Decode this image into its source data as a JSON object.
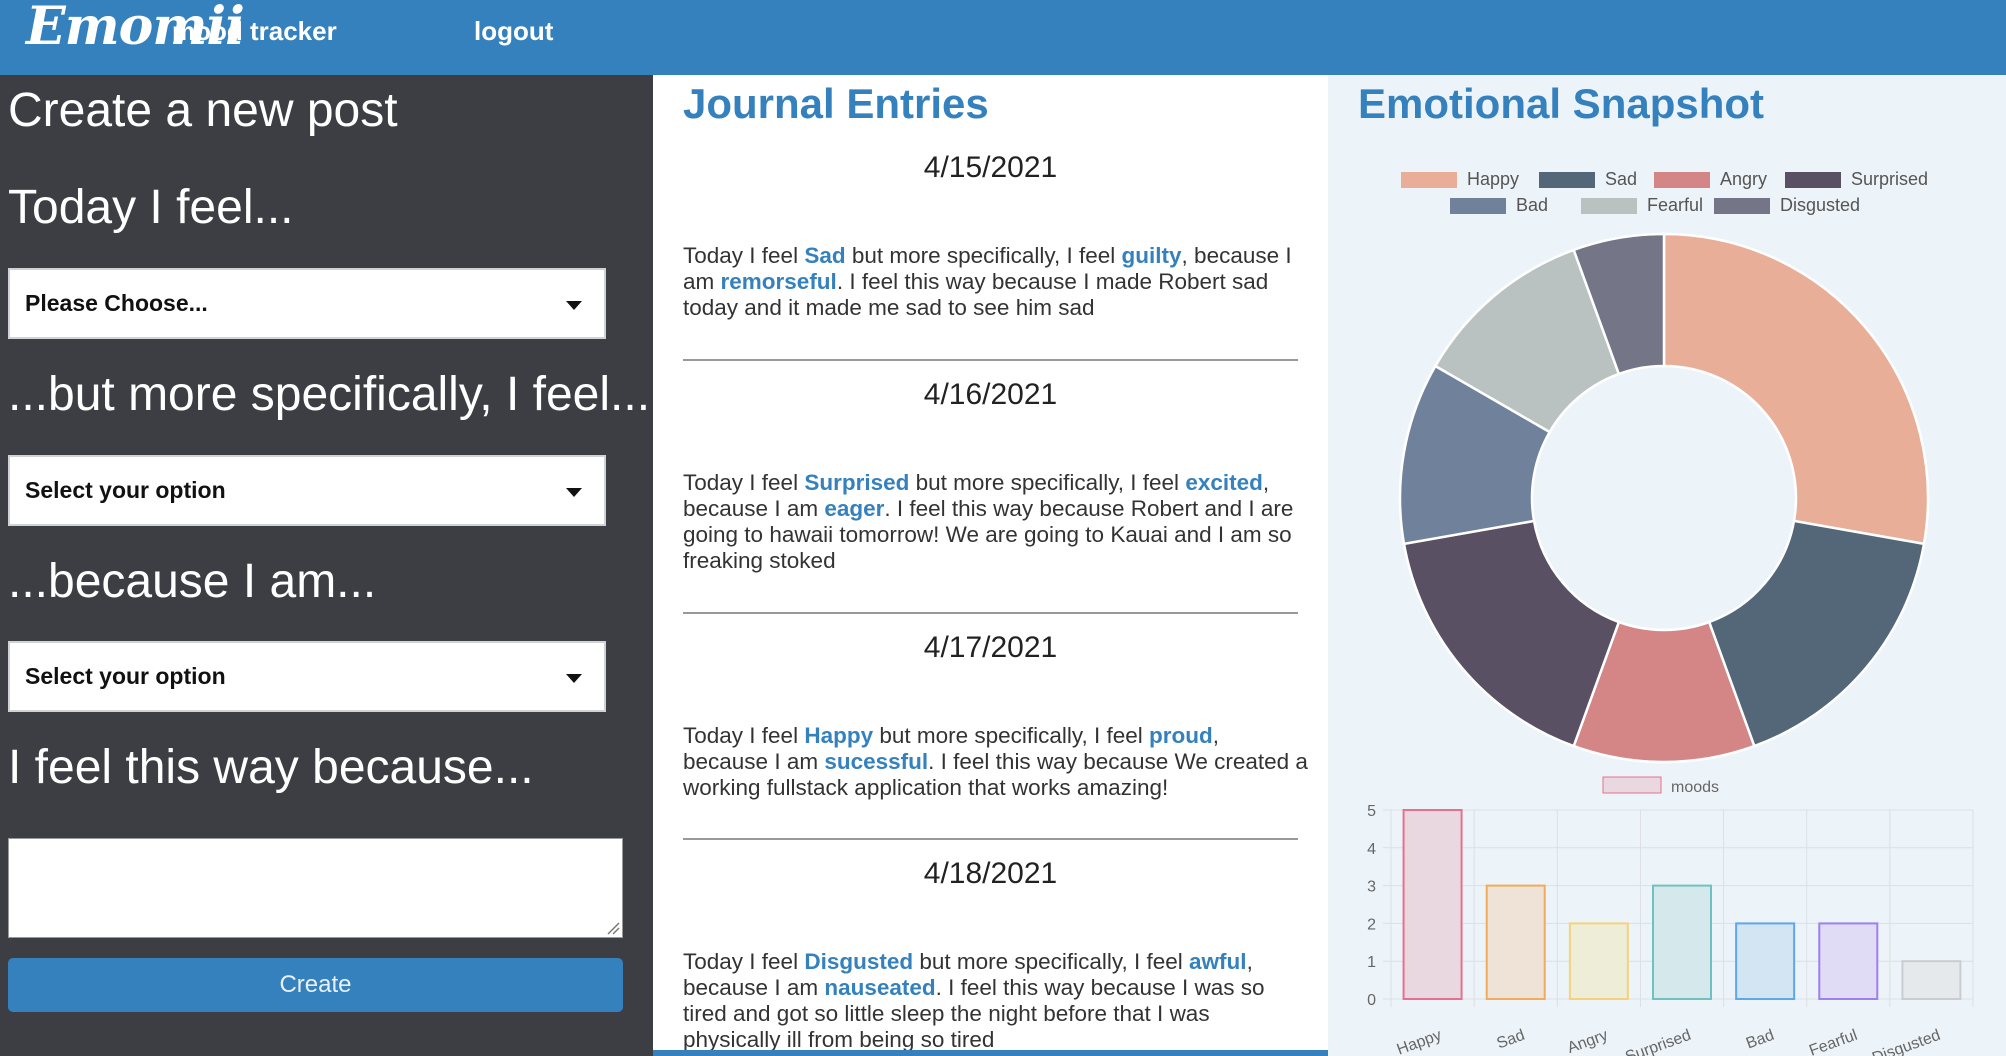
{
  "header": {
    "logo": "Emomii",
    "logo_sub": "mood tracker",
    "logout": "logout"
  },
  "form": {
    "title": "Create a new post",
    "feel_label": "Today I feel...",
    "feel_select": "Please Choose...",
    "specific_label": "...but more specifically, I feel...",
    "specific_select": "Select your option",
    "because_label": "...because I am...",
    "because_select": "Select your option",
    "reason_label": "I feel this way because...",
    "reason_value": "",
    "create_button": "Create"
  },
  "journal": {
    "title": "Journal Entries",
    "entries": [
      {
        "date": "4/15/2021",
        "prefix": "Today I feel ",
        "mood": "Sad",
        "mid1": " but more specifically, I feel ",
        "feeling": "guilty",
        "mid2": ", because I am ",
        "reason": "remorseful",
        "suffix": ". I feel this way because I made Robert sad today and it made me sad to see him sad"
      },
      {
        "date": "4/16/2021",
        "prefix": "Today I feel ",
        "mood": "Surprised",
        "mid1": " but more specifically, I feel ",
        "feeling": "excited",
        "mid2": ", because I am ",
        "reason": "eager",
        "suffix": ". I feel this way because Robert and I are going to hawaii tomorrow! We are going to Kauai and I am so freaking stoked"
      },
      {
        "date": "4/17/2021",
        "prefix": "Today I feel ",
        "mood": "Happy",
        "mid1": " but more specifically, I feel ",
        "feeling": "proud",
        "mid2": ", because I am ",
        "reason": "sucessful",
        "suffix": ". I feel this way because We created a working fullstack application that works amazing!"
      },
      {
        "date": "4/18/2021",
        "prefix": "Today I feel ",
        "mood": "Disgusted",
        "mid1": " but more specifically, I feel ",
        "feeling": "awful",
        "mid2": ", because I am ",
        "reason": "nauseated",
        "suffix": ". I feel this way because I was so tired and got so little sleep the night before that I was physically ill from being so tired"
      }
    ]
  },
  "snapshot": {
    "title": "Emotional Snapshot"
  },
  "chart_data": [
    {
      "type": "pie",
      "subtype": "doughnut",
      "legend_position": "top",
      "labels": [
        "Happy",
        "Sad",
        "Angry",
        "Surprised",
        "Bad",
        "Fearful",
        "Disgusted"
      ],
      "values": [
        5,
        3,
        2,
        3,
        2,
        2,
        1
      ],
      "colors": [
        "#e9ae97",
        "#536778",
        "#d48686",
        "#5a5064",
        "#6f819b",
        "#b9c2c1",
        "#757588"
      ]
    },
    {
      "type": "bar",
      "legend": [
        "moods"
      ],
      "legend_position": "top",
      "categories": [
        "Happy",
        "Sad",
        "Angry",
        "Surprised",
        "Bad",
        "Fearful",
        "Disgusted"
      ],
      "values": [
        5,
        3,
        2,
        3,
        2,
        2,
        1
      ],
      "ylim": [
        0,
        5
      ],
      "yticks": [
        "0",
        "1",
        "2",
        "3",
        "4",
        "5"
      ],
      "grid": true,
      "fill_colors": [
        "#ead8e0",
        "#eee3d6",
        "#eeedd8",
        "#d5e9ec",
        "#d3e4f3",
        "#e0dcf5",
        "#e6e9ec"
      ],
      "border_colors": [
        "#e6718e",
        "#f0ac5a",
        "#f4d27c",
        "#6ec1bf",
        "#5ea7e8",
        "#9f7ff0",
        "#c9cdd1"
      ],
      "legend_fill": "#ead8e0",
      "legend_border": "#e6718e"
    }
  ]
}
